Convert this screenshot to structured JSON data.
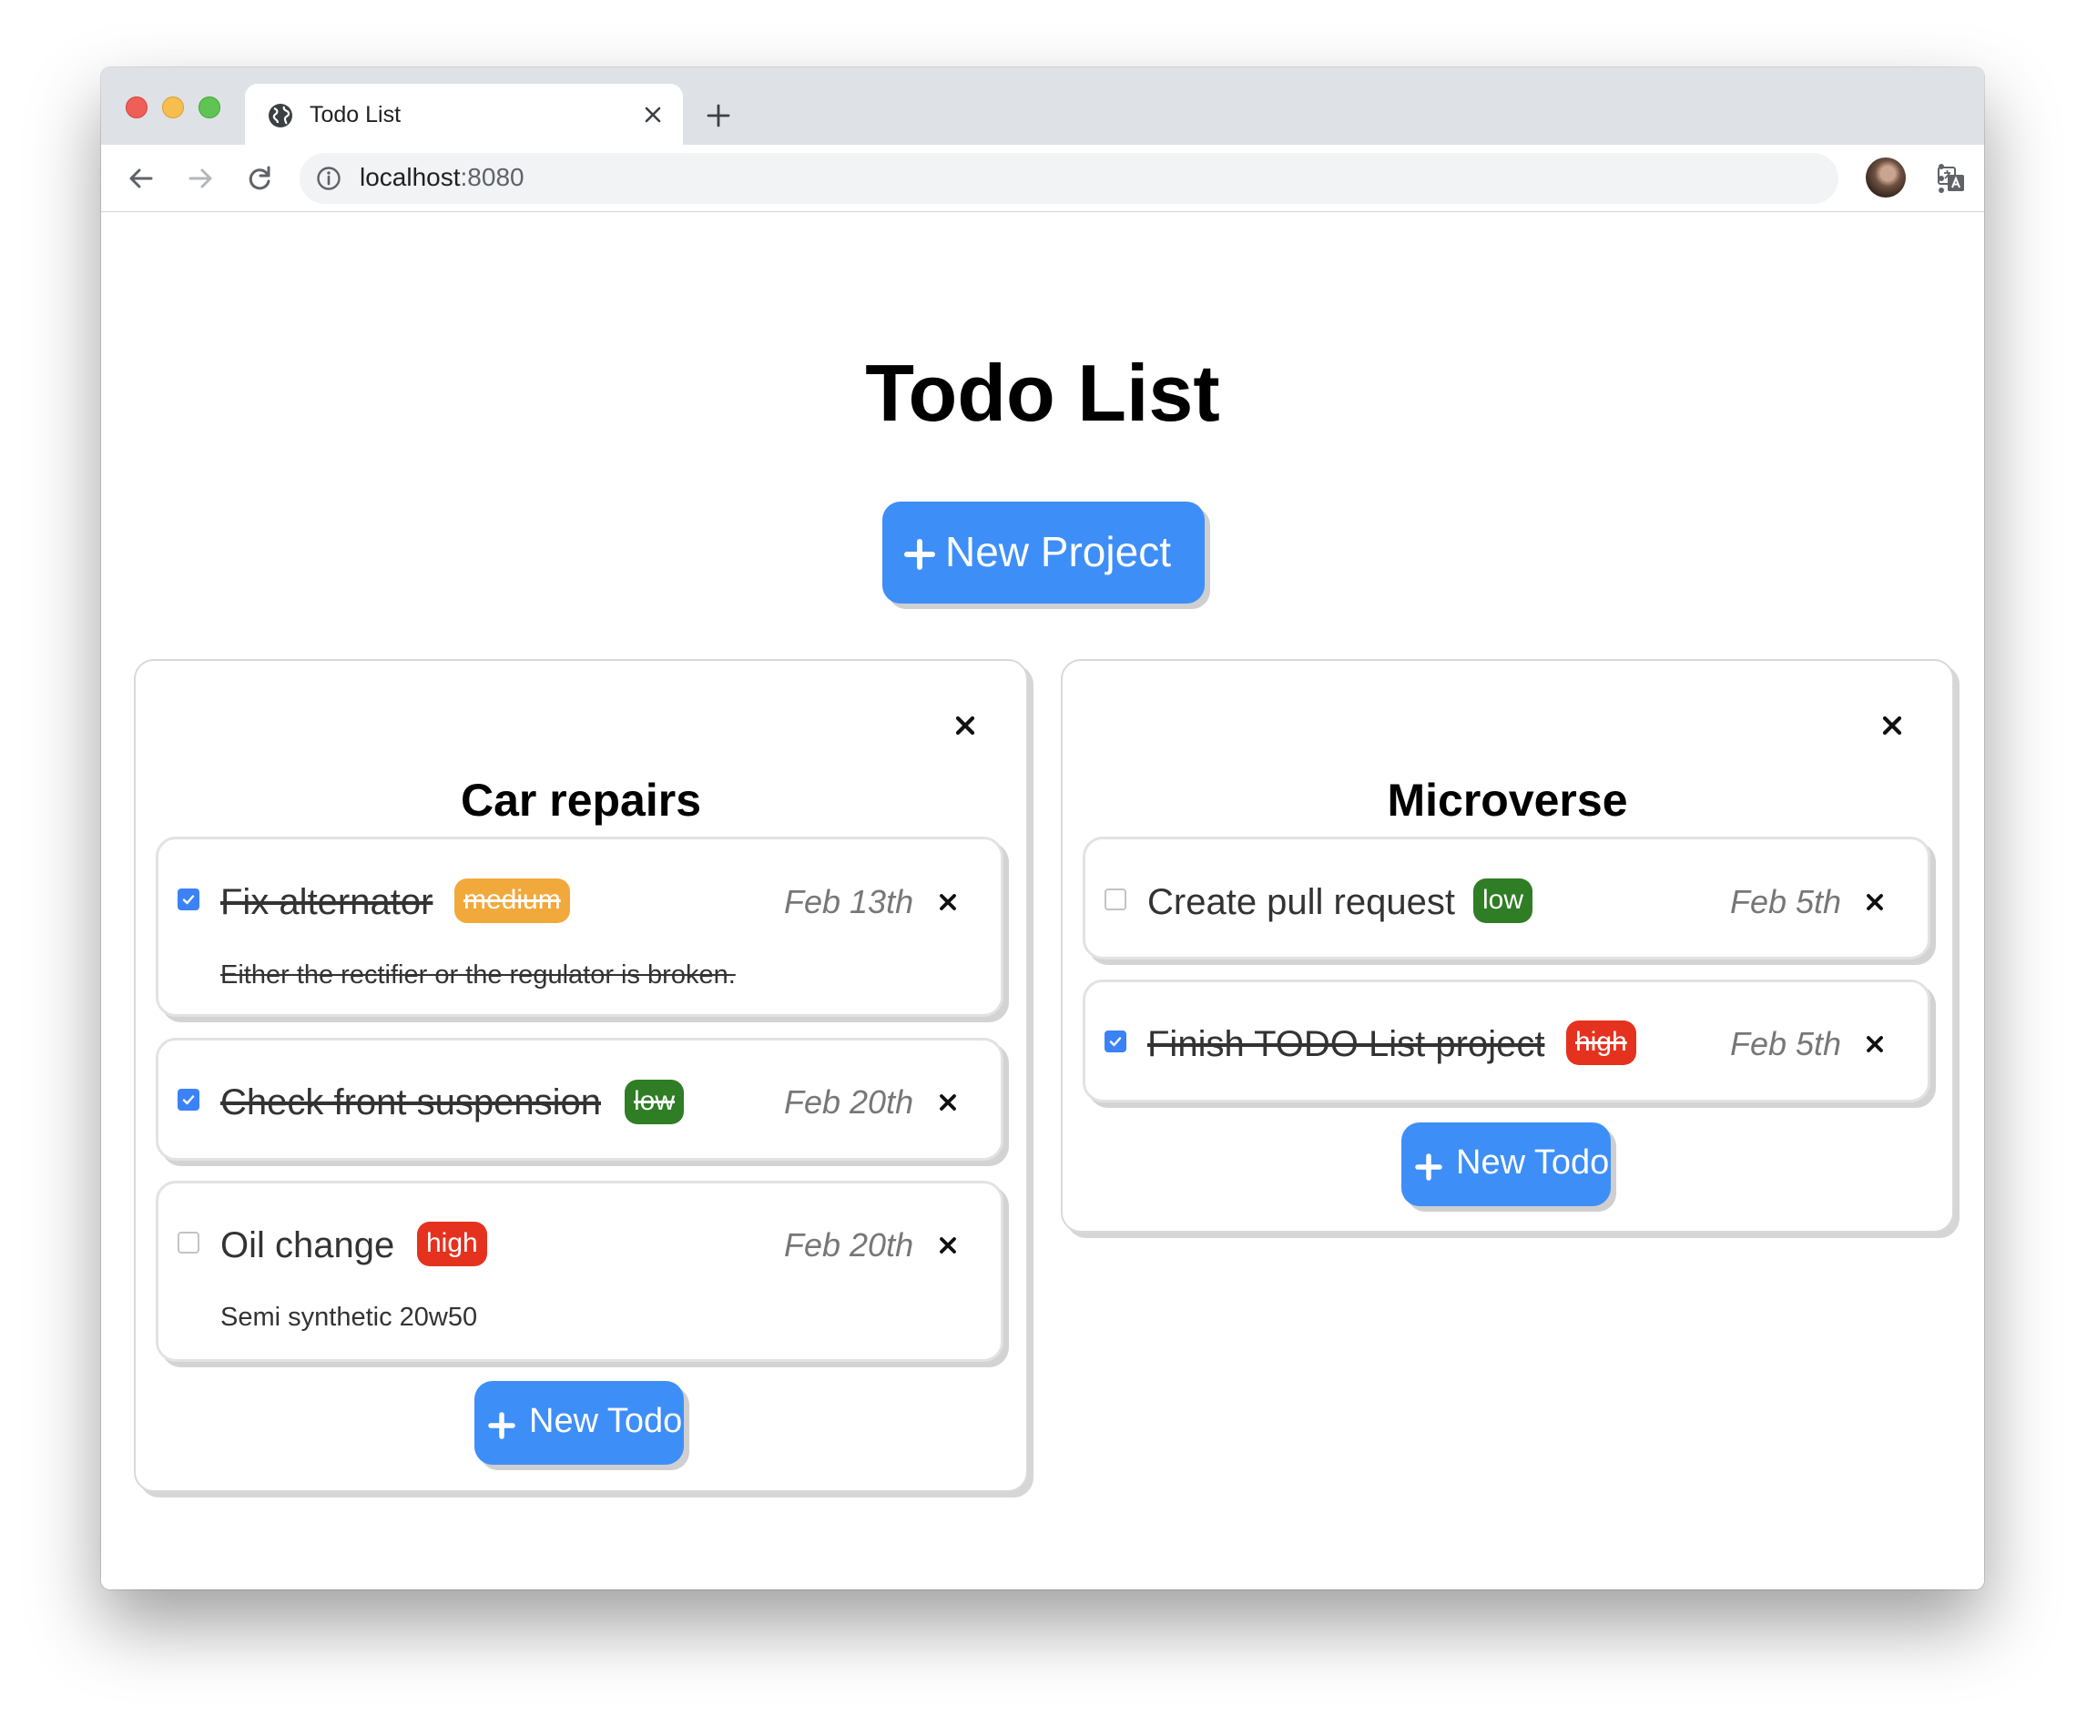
{
  "browser": {
    "tab_title": "Todo List",
    "url_host": "localhost",
    "url_port": ":8080"
  },
  "page": {
    "title": "Todo List",
    "new_project_label": "New Project"
  },
  "projects": [
    {
      "title": "Car repairs",
      "new_todo_label": "New Todo",
      "todos": [
        {
          "title": "Fix alternator",
          "priority": "medium",
          "date": "Feb 13th",
          "done": true,
          "note": "Either the rectifier or the regulator is broken."
        },
        {
          "title": "Check front suspension",
          "priority": "low",
          "date": "Feb 20th",
          "done": true,
          "note": ""
        },
        {
          "title": "Oil change",
          "priority": "high",
          "date": "Feb 20th",
          "done": false,
          "note": "Semi synthetic 20w50"
        }
      ]
    },
    {
      "title": "Microverse",
      "new_todo_label": "New Todo",
      "todos": [
        {
          "title": "Create pull request",
          "priority": "low",
          "date": "Feb 5th",
          "done": false,
          "note": ""
        },
        {
          "title": "Finish TODO List project",
          "priority": "high",
          "date": "Feb 5th",
          "done": true,
          "note": ""
        }
      ]
    }
  ],
  "colors": {
    "primary_button": "#3e8ef7",
    "priority_medium": "#f2a93b",
    "priority_low": "#2f7d24",
    "priority_high": "#e5321f",
    "checkbox_checked": "#3b82f6"
  },
  "icons": {
    "tab": "globe-icon",
    "close": "close-icon",
    "add": "plus-icon",
    "back": "arrow-left-icon",
    "forward": "arrow-right-icon",
    "reload": "reload-icon",
    "site_info": "info-icon",
    "translate": "translate-icon",
    "bookmark": "star-icon",
    "menu": "kebab-menu-icon"
  }
}
